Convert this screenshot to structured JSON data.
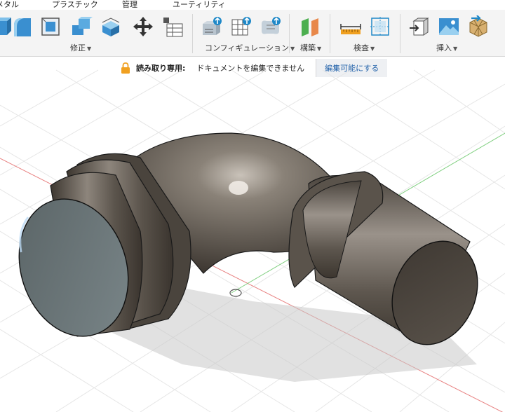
{
  "tabs": [
    "メタル",
    "プラスチック",
    "管理",
    "ユーティリティ"
  ],
  "groups": {
    "modify": "修正",
    "configuration": "コンフィギュレーション",
    "construct": "構築",
    "inspect": "検査",
    "insert": "挿入"
  },
  "banner": {
    "icon": "lock-icon",
    "read_only_label": "読み取り専用:",
    "message": "ドキュメントを編集できません",
    "edit_button": "編集可能にする"
  },
  "colors": {
    "ribbon_bg": "#f4f4f4",
    "accent_blue": "#1e88c8",
    "lock_orange": "#f0a020",
    "axis_red": "#e05050",
    "axis_green": "#50c050"
  }
}
